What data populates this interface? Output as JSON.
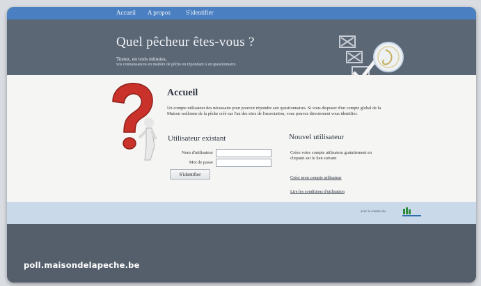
{
  "nav": {
    "items": [
      "Accueil",
      "A propos",
      "S'identifier"
    ]
  },
  "banner": {
    "title": "Quel pêcheur êtes-vous ?",
    "subtitle": "Testez, en trois minutes,",
    "subtitle2": "vos connaissances en matière de pêche en répondant à un questionnaire."
  },
  "main": {
    "heading": "Accueil",
    "intro": "Un compte utilisateur des nécessaire pour pouvoir répondre aux questionnaires. Si vous disposez d'un compte global de la Maison wallonne de la pêche créé sur l'un des sites de l'association, vous pouvez directement vous identifier.",
    "existing": {
      "title": "Utilisateur existant",
      "username_label": "Nom d'utilisateur",
      "password_label": "Mot de passe",
      "username_value": "",
      "password_value": "",
      "submit_label": "S'identifier"
    },
    "new_user": {
      "title": "Nouvel utilisateur",
      "description": "Créez votre compte utilisateur gratuitement en cliquant sur le lien suivant",
      "create_link": "Créer mon compte utilisateur",
      "terms_link": "Lire les conditions d'utilisation"
    }
  },
  "footer": {
    "credit": "avec le soutien du"
  },
  "overlay": {
    "url": "poll.maisondelapeche.be"
  },
  "colors": {
    "nav_bar": "#4a7fc1",
    "banner": "#5c6776",
    "footer_strip": "#c9d9ea",
    "question_mark": "#c8322a"
  }
}
